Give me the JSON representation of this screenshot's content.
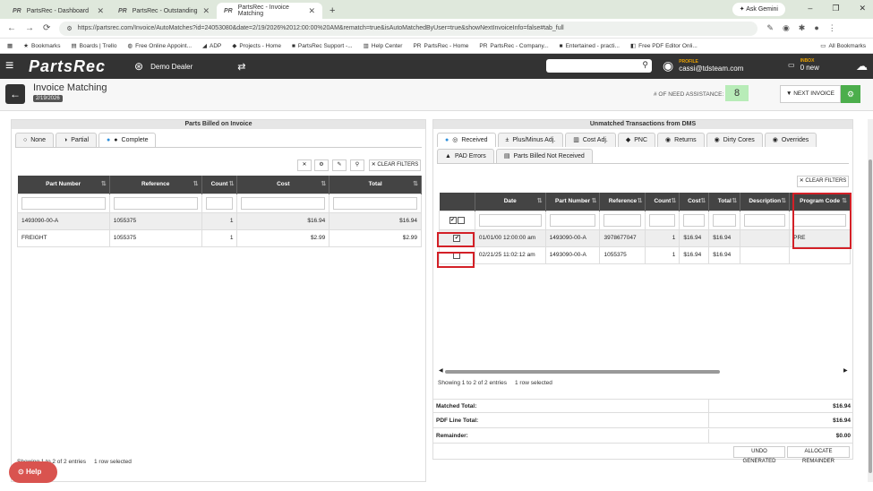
{
  "browser": {
    "tabs": [
      {
        "label": "PartsRec - Dashboard",
        "active": false
      },
      {
        "label": "PartsRec - Outstanding",
        "active": false
      },
      {
        "label": "PartsRec - Invoice Matching",
        "active": true
      }
    ],
    "tab_favicon": "PR",
    "gemini_label": "Ask Gemini",
    "url": "https://partsrec.com/Invoice/AutoMatches?id=24053080&date=2/19/2026%2012:00:00%20AM&rematch=true&isAutoMatchedByUser=true&showNextInvoiceInfo=false#tab_full",
    "bookmarks": [
      "Bookmarks",
      "Boards | Trello",
      "Free Online Appoint...",
      "ADP",
      "Projects - Home",
      "PartsRec Support -...",
      "Help Center",
      "PartsRec - Home",
      "PartsRec - Company...",
      "Entertained - practi...",
      "Free PDF Editor Onli..."
    ],
    "all_bookmarks": "All Bookmarks"
  },
  "app": {
    "logo": "PartsRec",
    "dealer": "Demo Dealer",
    "profile_label": "PROFILE",
    "profile_email": "cassi@tdsteam.com",
    "inbox_label": "INBOX",
    "inbox_value": "0 new"
  },
  "titlebar": {
    "title": "Invoice Matching",
    "date": "2/19/2026",
    "need_label": "# OF NEED ASSISTANCE:",
    "need_value": "8",
    "next_invoice": "NEXT INVOICE"
  },
  "left": {
    "header": "Parts Billed on Invoice",
    "tabs": [
      "None",
      "Partial",
      "Complete"
    ],
    "clear_filters": "CLEAR FILTERS",
    "columns": [
      "Part Number",
      "Reference",
      "Count",
      "Cost",
      "Total"
    ],
    "rows": [
      [
        "1493090-00-A",
        "1055375",
        "1",
        "$16.94",
        "$16.94"
      ],
      [
        "FREIGHT",
        "1055375",
        "1",
        "$2.99",
        "$2.99"
      ]
    ],
    "footer_showing": "Showing 1 to 2 of 2 entries",
    "footer_selected": "1 row selected"
  },
  "right": {
    "header": "Unmatched Transactions from DMS",
    "tabs": [
      "Received",
      "Plus/Minus Adj.",
      "Cost Adj.",
      "PNC",
      "Returns",
      "Dirty Cores",
      "Overrides",
      "PAD Errors",
      "Parts Billed Not Received"
    ],
    "clear_filters": "CLEAR FILTERS",
    "columns": [
      "Date",
      "Part Number",
      "Reference",
      "Count",
      "Cost",
      "Total",
      "Description",
      "Program Code"
    ],
    "rows": [
      {
        "checked": true,
        "cells": [
          "01/01/00 12:00:00 am",
          "1493090-00-A",
          "3978677047",
          "1",
          "$16.94",
          "$16.94",
          "",
          "PRE"
        ]
      },
      {
        "checked": false,
        "cells": [
          "02/21/25 11:02:12 am",
          "1493090-00-A",
          "1055375",
          "1",
          "$16.94",
          "$16.94",
          "",
          ""
        ]
      }
    ],
    "footer_showing": "Showing 1 to 2 of 2 entries",
    "footer_selected": "1 row selected",
    "summary": [
      {
        "label": "Matched Total:",
        "value": "$16.94"
      },
      {
        "label": "PDF Line Total:",
        "value": "$16.94"
      },
      {
        "label": "Remainder:",
        "value": "$0.00"
      }
    ],
    "undo_generated": "UNDO GENERATED",
    "allocate_remainder": "ALLOCATE REMAINDER"
  },
  "help_label": "Help"
}
